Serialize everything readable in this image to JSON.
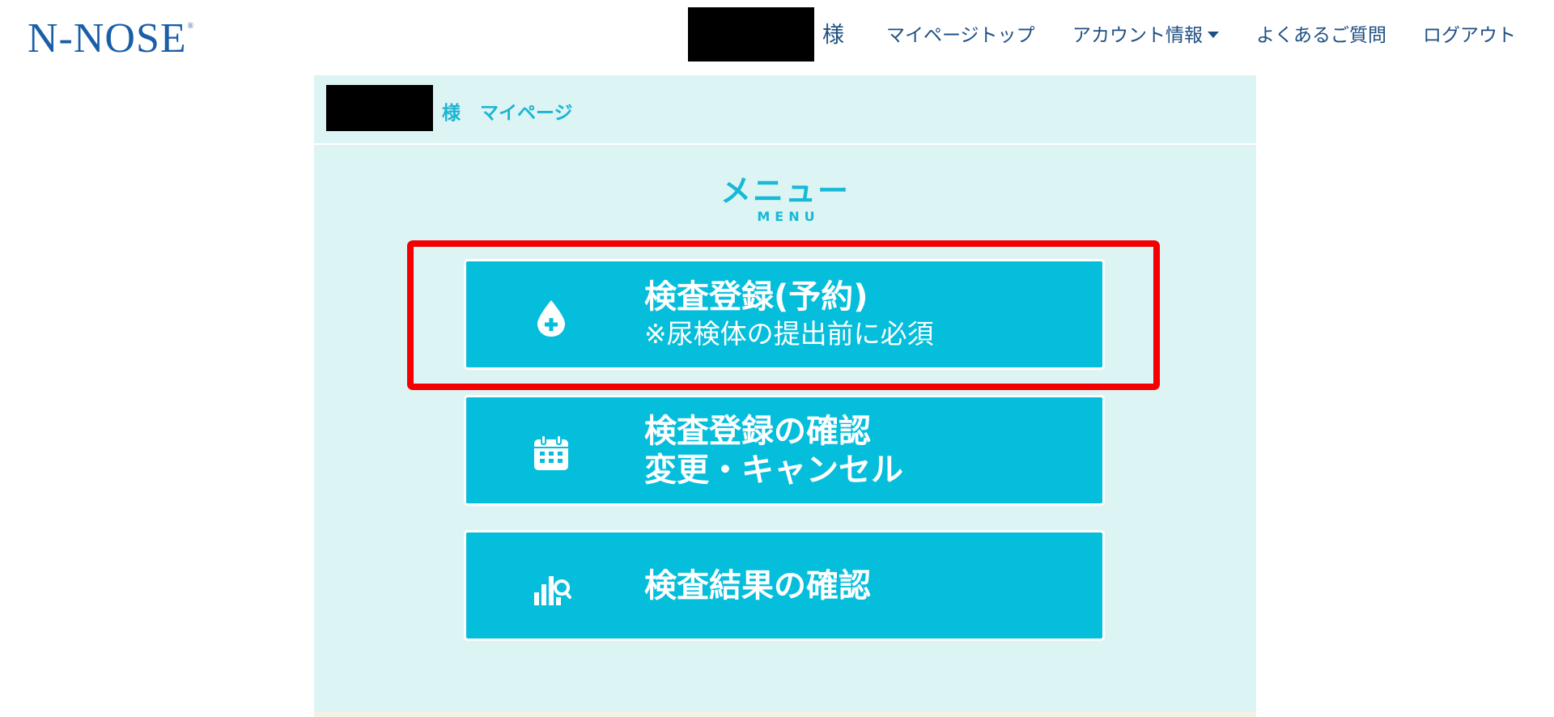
{
  "header": {
    "logo_text": "N-NOSE",
    "logo_mark": "®",
    "user_suffix": "様",
    "nav": {
      "mypage_top": "マイページトップ",
      "account_info": "アカウント情報",
      "faq": "よくあるご質問",
      "logout": "ログアウト"
    }
  },
  "breadcrumb": {
    "suffix": "様",
    "page": "マイページ"
  },
  "menu": {
    "title": "メニュー",
    "subtitle": "MENU",
    "buttons": [
      {
        "line1": "検査登録(予約)",
        "line2": "※尿検体の提出前に必須",
        "icon": "blood-drop-plus-icon"
      },
      {
        "line1": "検査登録の確認",
        "line2": "変更・キャンセル",
        "icon": "calendar-icon"
      },
      {
        "line1": "検査結果の確認",
        "icon": "chart-search-icon"
      }
    ]
  },
  "colors": {
    "brand_blue": "#1a5ea8",
    "nav_text": "#1f4f82",
    "panel_bg": "#ddf4f4",
    "accent_cyan": "#05bedb",
    "menu_title": "#18b9d6",
    "highlight_red": "#f40000"
  }
}
